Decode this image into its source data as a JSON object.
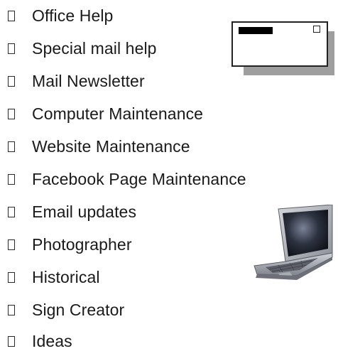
{
  "checklist": {
    "items": [
      {
        "label": "Office Help"
      },
      {
        "label": "Special mail help"
      },
      {
        "label": "Mail Newsletter"
      },
      {
        "label": "Computer Maintenance"
      },
      {
        "label": "Website Maintenance"
      },
      {
        "label": "Facebook Page Maintenance"
      },
      {
        "label": "Email updates"
      },
      {
        "label": "Photographer"
      },
      {
        "label": "Historical"
      },
      {
        "label": "Sign Creator"
      },
      {
        "label": "Ideas"
      }
    ]
  },
  "illustrations": {
    "window_icon": "window-icon",
    "laptop_icon": "laptop-icon"
  }
}
